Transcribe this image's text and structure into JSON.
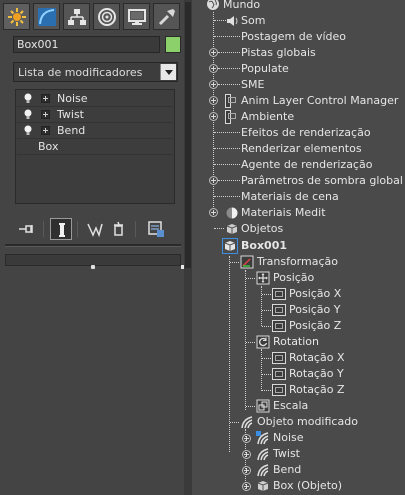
{
  "left_panel": {
    "tabs": [
      {
        "icon": "create-icon",
        "active": true
      },
      {
        "icon": "modify-icon",
        "active": false
      },
      {
        "icon": "hierarchy-icon",
        "active": false
      },
      {
        "icon": "motion-icon",
        "active": false
      },
      {
        "icon": "display-icon",
        "active": false
      },
      {
        "icon": "utilities-icon",
        "active": false
      }
    ],
    "object_name": "Box001",
    "object_color": "#8bd06b",
    "modifier_list_label": "Lista de modificadores",
    "stack": {
      "modifiers": [
        "Noise",
        "Twist",
        "Bend"
      ],
      "base": "Box"
    },
    "toolbar": [
      "pin-stack-icon",
      "show-end-result-icon",
      "make-unique-icon",
      "remove-modifier-icon",
      "configure-modifier-sets-icon"
    ]
  },
  "tree": {
    "world": "Mundo",
    "items": {
      "som": "Som",
      "postagem": "Postagem de vídeo",
      "pistas": "Pistas globais",
      "populate": "Populate",
      "sme": "SME",
      "anim_layer": "Anim Layer Control Manager",
      "ambiente": "Ambiente",
      "efeitos": "Efeitos de renderização",
      "renderizar": "Renderizar elementos",
      "agente": "Agente de renderização",
      "parametros": "Parâmetros de sombra global",
      "materiais_cena": "Materiais de cena",
      "materiais_medit": "Materiais Medit",
      "objetos": "Objetos",
      "box": "Box001",
      "transformacao": "Transformação",
      "posicao": "Posição",
      "posicao_x": "Posição X",
      "posicao_y": "Posição Y",
      "posicao_z": "Posição Z",
      "rotation": "Rotation",
      "rotacao_x": "Rotação X",
      "rotacao_y": "Rotação Y",
      "rotacao_z": "Rotação Z",
      "escala": "Escala",
      "objeto_modificado": "Objeto modificado",
      "noise": "Noise",
      "twist": "Twist",
      "bend": "Bend",
      "box_objeto": "Box (Objeto)"
    }
  }
}
